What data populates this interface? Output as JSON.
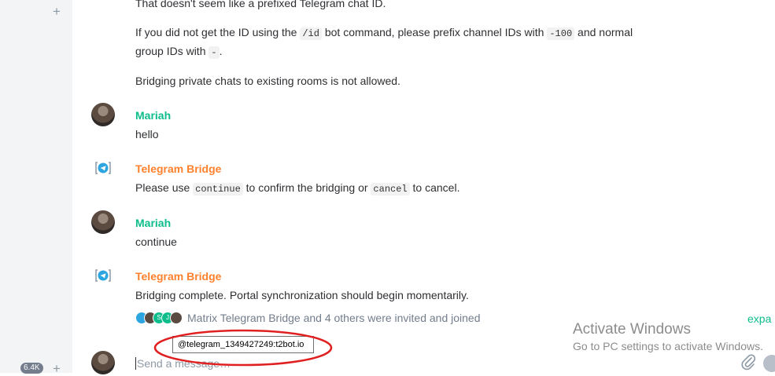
{
  "sidebar": {
    "count_badge": "6.4K"
  },
  "timeline": {
    "error_line": "That doesn't seem like a prefixed Telegram chat ID.",
    "id_hint": {
      "a": "If you did not get the ID using the",
      "cmd": "/id",
      "b": "bot command, please prefix channel IDs with",
      "prefix": "-100",
      "c": "and normal",
      "d": "group IDs with",
      "dash": "-",
      "e": "."
    },
    "private_note": "Bridging private chats to existing rooms is not allowed.",
    "messages": [
      {
        "sender": "Mariah",
        "body": "hello"
      },
      {
        "sender": "Telegram Bridge",
        "body_a": "Please use",
        "code1": "continue",
        "body_b": "to confirm the bridging or",
        "code2": "cancel",
        "body_c": "to cancel."
      },
      {
        "sender": "Mariah",
        "body": "continue"
      },
      {
        "sender": "Telegram Bridge",
        "body": "Bridging complete. Portal synchronization should begin momentarily."
      }
    ],
    "membership": "Matrix Telegram Bridge and 4 others were invited and joined",
    "membership_avatar_letters": [
      "S",
      "J"
    ]
  },
  "tooltip": "@telegram_1349427249:t2bot.io",
  "composer": {
    "placeholder": "Send a message…"
  },
  "watermark": {
    "title": "Activate Windows",
    "subtitle": "Go to PC settings to activate Windows.",
    "expand_label": "expa"
  },
  "colors": {
    "mariah": "#0dbd8b",
    "bridge": "#ff812d",
    "annotation_circle": "#e02020"
  }
}
